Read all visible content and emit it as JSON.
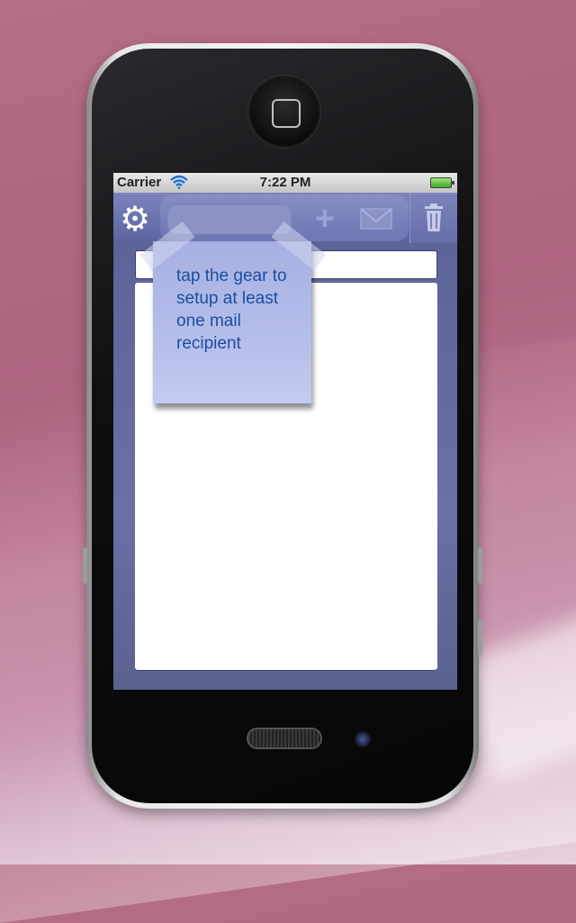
{
  "statusbar": {
    "carrier": "Carrier",
    "time": "7:22 PM",
    "battery": "full"
  },
  "toolbar": {
    "settings_icon": "gear-icon",
    "add_icon": "plus-icon",
    "mail_icon": "envelope-icon",
    "trash_icon": "trash-icon"
  },
  "note": {
    "text": "tap the gear to setup at least one mail recipient"
  },
  "colors": {
    "accent": "#5b649d",
    "note_text": "#1d4ea0",
    "note_bg": "#b8c1ec"
  }
}
